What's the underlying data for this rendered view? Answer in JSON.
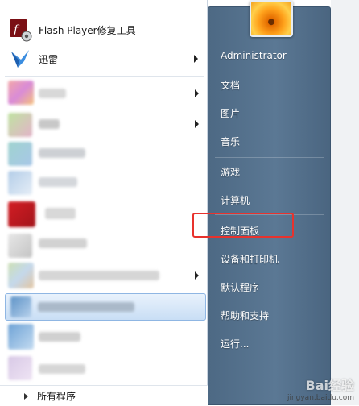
{
  "left_pane": {
    "pinned": [
      {
        "label": "Flash Player修复工具",
        "icon": "flash-player-icon",
        "has_submenu": false
      },
      {
        "label": "迅雷",
        "icon": "xunlei-bird-icon",
        "has_submenu": true
      }
    ],
    "all_programs_label": "所有程序"
  },
  "right_pane": {
    "items": [
      {
        "label": "Administrator"
      },
      {
        "label": "文档"
      },
      {
        "label": "图片"
      },
      {
        "label": "音乐"
      },
      {
        "label": "游戏"
      },
      {
        "label": "计算机"
      },
      {
        "label": "控制面板"
      },
      {
        "label": "设备和打印机"
      },
      {
        "label": "默认程序"
      },
      {
        "label": "帮助和支持"
      },
      {
        "label": "运行..."
      }
    ]
  },
  "annotation": {
    "highlighted_item": "控制面板",
    "color": "#e8322d"
  },
  "watermark": {
    "brand": "Bai经验",
    "url": "jingyan.baidu.com"
  },
  "colors": {
    "right_pane_bg": "#5b7894",
    "hover_bg": "#c9def5",
    "annotation_red": "#e8322d"
  }
}
